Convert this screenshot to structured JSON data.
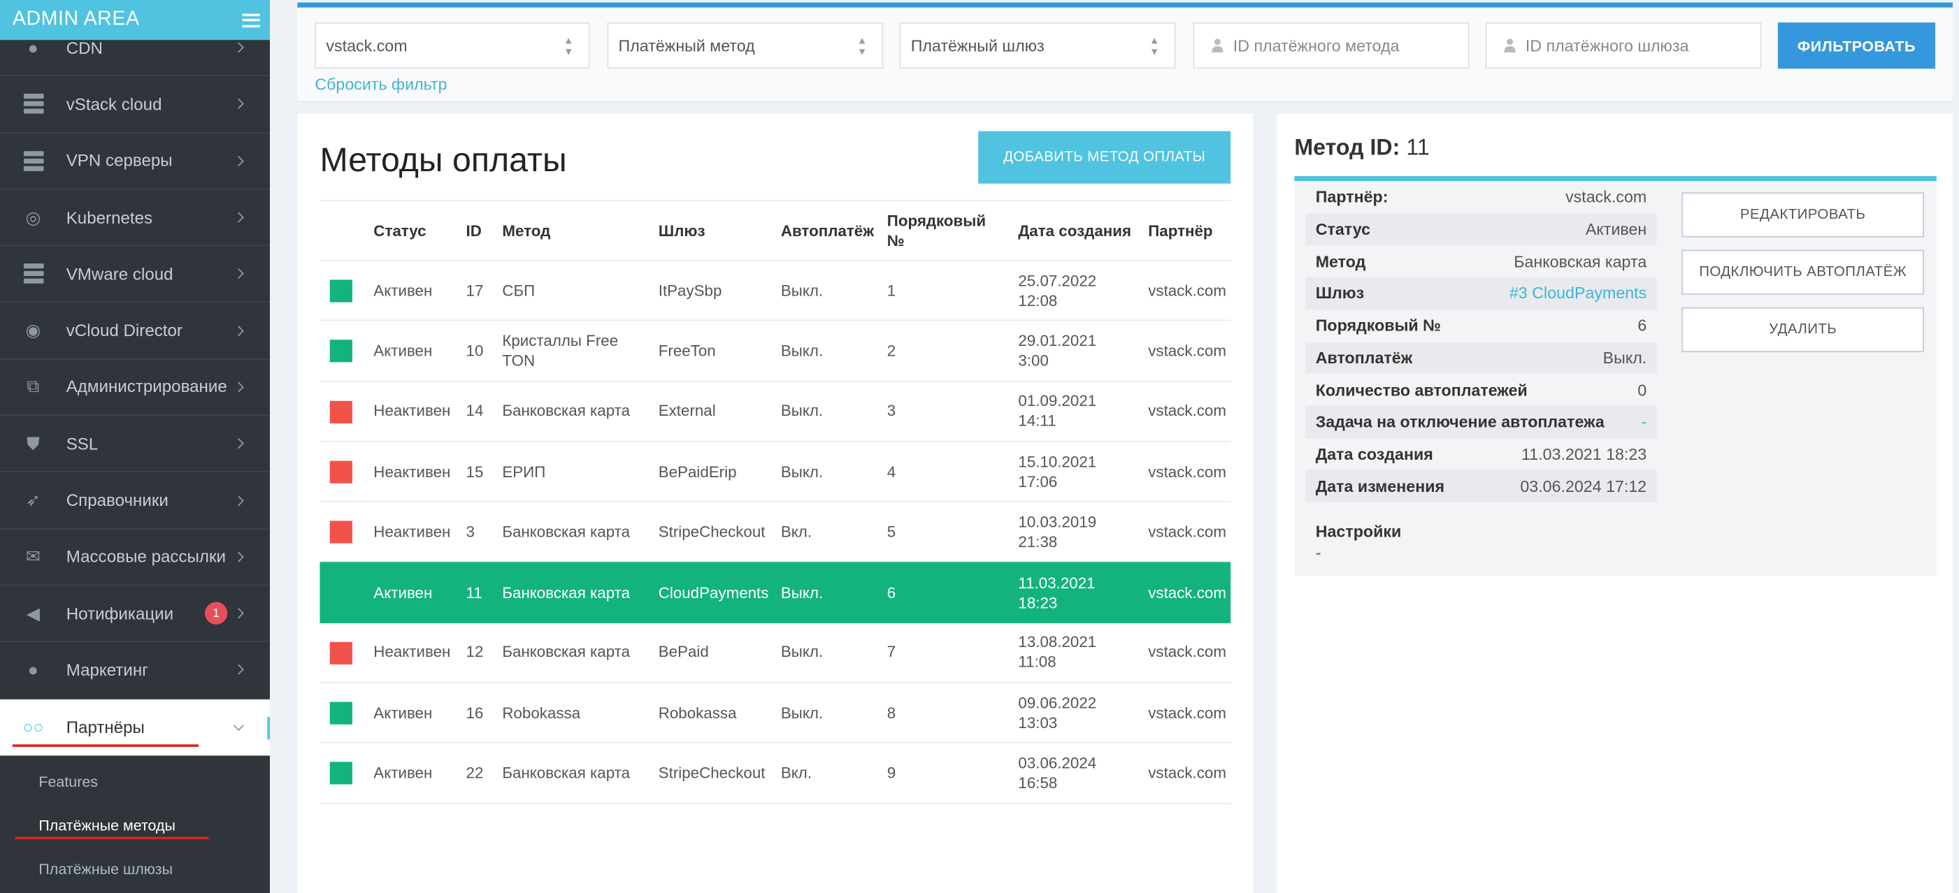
{
  "sidebar": {
    "title": "ADMIN AREA",
    "items": [
      {
        "label": "CDN",
        "icon": "globe-icon"
      },
      {
        "label": "vStack cloud",
        "icon": "server-icon"
      },
      {
        "label": "VPN серверы",
        "icon": "server-icon"
      },
      {
        "label": "Kubernetes",
        "icon": "lifebuoy-icon"
      },
      {
        "label": "VMware cloud",
        "icon": "server-icon"
      },
      {
        "label": "vCloud Director",
        "icon": "podcast-icon"
      },
      {
        "label": "Администрирование",
        "icon": "sitemap-icon"
      },
      {
        "label": "SSL",
        "icon": "shield-icon"
      },
      {
        "label": "Справочники",
        "icon": "rocket-icon"
      },
      {
        "label": "Массовые рассылки",
        "icon": "envelope-icon"
      },
      {
        "label": "Нотификации",
        "icon": "volume-icon",
        "badge": "1"
      },
      {
        "label": "Маркетинг",
        "icon": "piggy-bank-icon"
      },
      {
        "label": "Партнёры",
        "icon": "glasses-icon"
      }
    ],
    "subitems": [
      {
        "label": "Features"
      },
      {
        "label": "Платёжные методы"
      },
      {
        "label": "Платёжные шлюзы"
      }
    ]
  },
  "filter": {
    "partner_value": "vstack.com",
    "method_value": "Платёжный метод",
    "gateway_value": "Платёжный шлюз",
    "method_id_placeholder": "ID платёжного метода",
    "gateway_id_placeholder": "ID платёжного шлюза",
    "filter_button": "ФИЛЬТРОВАТЬ",
    "reset_link": "Сбросить фильтр"
  },
  "main": {
    "title": "Методы оплаты",
    "add_button": "ДОБАВИТЬ МЕТОД ОПЛАТЫ",
    "columns": [
      "Статус",
      "ID",
      "Метод",
      "Шлюз",
      "Автоплатёж",
      "Порядковый №",
      "Дата создания",
      "Партнёр"
    ],
    "rows": [
      {
        "indicator": "#13b37d",
        "status": "Активен",
        "id": "17",
        "method": "СБП",
        "gateway": "ItPaySbp",
        "autopay": "Выкл.",
        "order": "1",
        "created": "25.07.2022 12:08",
        "partner": "vstack.com"
      },
      {
        "indicator": "#13b37d",
        "status": "Активен",
        "id": "10",
        "method": "Кристаллы Free TON",
        "gateway": "FreeTon",
        "autopay": "Выкл.",
        "order": "2",
        "created": "29.01.2021 3:00",
        "partner": "vstack.com"
      },
      {
        "indicator": "#f1534a",
        "status": "Неактивен",
        "id": "14",
        "method": "Банковская карта",
        "gateway": "External",
        "autopay": "Выкл.",
        "order": "3",
        "created": "01.09.2021 14:11",
        "partner": "vstack.com"
      },
      {
        "indicator": "#f1534a",
        "status": "Неактивен",
        "id": "15",
        "method": "ЕРИП",
        "gateway": "BePaidErip",
        "autopay": "Выкл.",
        "order": "4",
        "created": "15.10.2021 17:06",
        "partner": "vstack.com"
      },
      {
        "indicator": "#f1534a",
        "status": "Неактивен",
        "id": "3",
        "method": "Банковская карта",
        "gateway": "StripeCheckout",
        "autopay": "Вкл.",
        "order": "5",
        "created": "10.03.2019 21:38",
        "partner": "vstack.com"
      },
      {
        "indicator": "#13b37d",
        "status": "Активен",
        "id": "11",
        "method": "Банковская карта",
        "gateway": "CloudPayments",
        "autopay": "Выкл.",
        "order": "6",
        "created": "11.03.2021 18:23",
        "partner": "vstack.com",
        "selected": true
      },
      {
        "indicator": "#f1534a",
        "status": "Неактивен",
        "id": "12",
        "method": "Банковская карта",
        "gateway": "BePaid",
        "autopay": "Выкл.",
        "order": "7",
        "created": "13.08.2021 11:08",
        "partner": "vstack.com"
      },
      {
        "indicator": "#13b37d",
        "status": "Активен",
        "id": "16",
        "method": "Robokassa",
        "gateway": "Robokassa",
        "autopay": "Выкл.",
        "order": "8",
        "created": "09.06.2022 13:03",
        "partner": "vstack.com"
      },
      {
        "indicator": "#13b37d",
        "status": "Активен",
        "id": "22",
        "method": "Банковская карта",
        "gateway": "StripeCheckout",
        "autopay": "Вкл.",
        "order": "9",
        "created": "03.06.2024 16:58",
        "partner": "vstack.com"
      }
    ]
  },
  "detail": {
    "title_label": "Метод ID:",
    "title_id": "11",
    "rows": [
      {
        "key": "Партнёр:",
        "value": "vstack.com"
      },
      {
        "key": "Статус",
        "value": "Активен"
      },
      {
        "key": "Метод",
        "value": "Банковская карта"
      },
      {
        "key": "Шлюз",
        "value": "#3 CloudPayments",
        "link": true
      },
      {
        "key": "Порядковый №",
        "value": "6"
      },
      {
        "key": "Автоплатёж",
        "value": "Выкл."
      },
      {
        "key": "Количество автоплатежей",
        "value": "0"
      },
      {
        "key": "Задача на отключение автоплатежа",
        "value": "-",
        "link": true
      },
      {
        "key": "Дата создания",
        "value": "11.03.2021 18:23"
      },
      {
        "key": "Дата изменения",
        "value": "03.06.2024 17:12"
      }
    ],
    "settings_label": "Настройки",
    "settings_value": "-",
    "edit_button": "РЕДАКТИРОВАТЬ",
    "autopay_button": "ПОДКЛЮЧИТЬ АВТОПЛАТЁЖ",
    "delete_button": "УДАЛИТЬ"
  },
  "colors": {
    "accent": "#4fc3e0",
    "primary": "#3598dc",
    "active": "#13b37d",
    "inactive": "#f1534a",
    "sidebar": "#2f353b"
  }
}
